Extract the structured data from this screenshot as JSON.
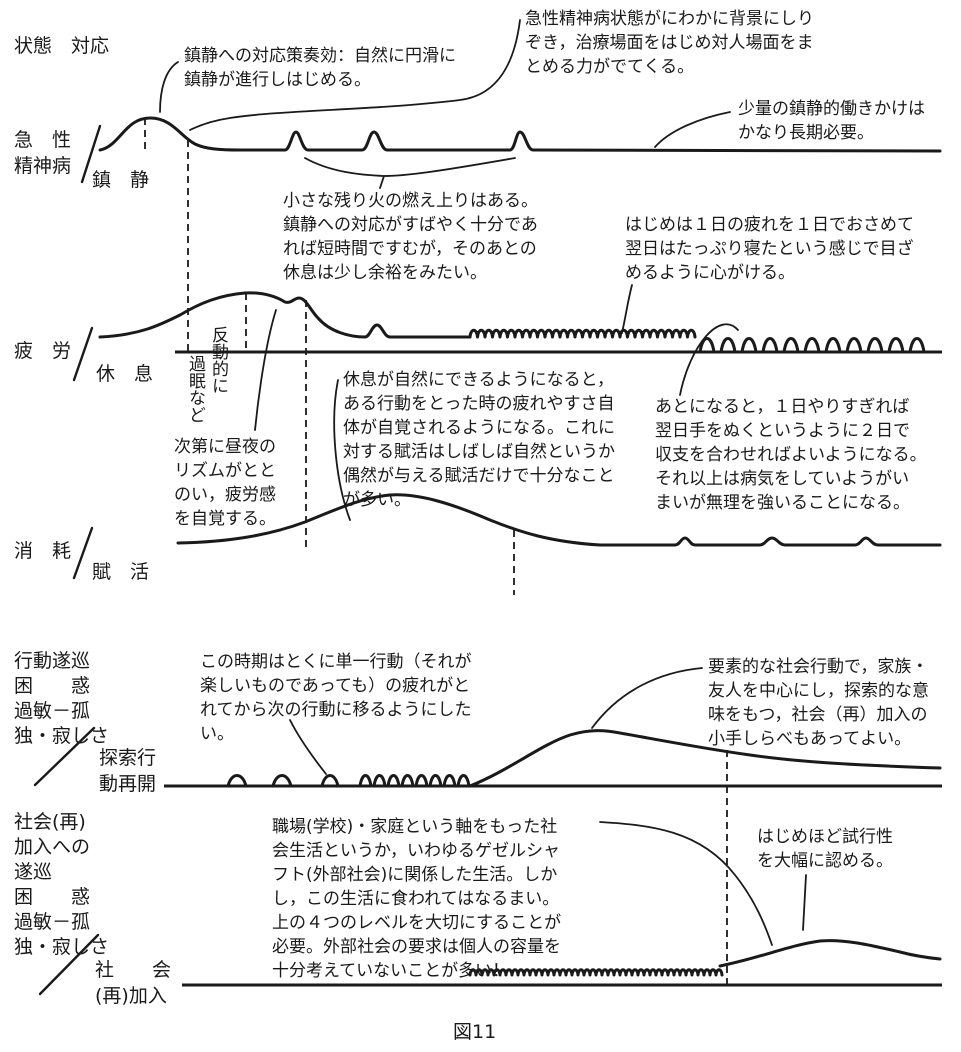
{
  "header": "状態　対応",
  "caption": "図11",
  "rows": {
    "acute": {
      "left": [
        "急　性",
        "精神病"
      ],
      "right": "鎮　静"
    },
    "fatigue": {
      "left": "疲　労",
      "right": "休　息"
    },
    "fatigue_vertical": [
      "反動的に",
      "過眠など"
    ],
    "consume": {
      "left": "消　耗",
      "right": "賦　活"
    },
    "behavior": {
      "left": [
        "行動遂巡",
        "困　　惑",
        "過敏－孤",
        "独・寂しさ"
      ],
      "right": [
        "探索行",
        "動再開"
      ]
    },
    "social": {
      "left": [
        "社会(再)",
        "加入への",
        "遂巡",
        "困　　惑",
        "過敏－孤",
        "独・寂しさ"
      ],
      "right": [
        "社　　会",
        "(再)加入"
      ]
    }
  },
  "notes": {
    "n1": [
      "鎮静への対応策奏効：自然に円滑に",
      "鎮静が進行しはじめる。"
    ],
    "n2": [
      "急性精神病状態がにわかに背景にしり",
      "ぞき，治療場面をはじめ対人場面をま",
      "とめる力がでてくる。"
    ],
    "n3": [
      "少量の鎮静的働きかけは",
      "かなり長期必要。"
    ],
    "n4": [
      "小さな残り火の燃え上りはある。",
      "鎮静への対応がすばやく十分であ",
      "れば短時間ですむが，そのあとの",
      "休息は少し余裕をみたい。"
    ],
    "n5": [
      "はじめは１日の疲れを１日でおさめて",
      "翌日はたっぷり寝たという感じで目ざ",
      "めるように心がける。"
    ],
    "n6": [
      "次第に昼夜の",
      "リズムがとと",
      "のい，疲労感",
      "を自覚する。"
    ],
    "n7": [
      "休息が自然にできるようになると，",
      "ある行動をとった時の疲れやすさ自",
      "体が自覚されるようになる。これに",
      "対する賦活はしばしば自然というか",
      "偶然が与える賦活だけで十分なこと",
      "が多い。"
    ],
    "n8": [
      "あとになると，１日やりすぎれば",
      "翌日手をぬくというように２日で",
      "収支を合わせればよいようになる。",
      "それ以上は病気をしていようがい",
      "まいが無理を強いることになる。"
    ],
    "n9": [
      "この時期はとくに単一行動（それが",
      "楽しいものであっても）の疲れがと",
      "れてから次の行動に移るようにした",
      "い。"
    ],
    "n10": [
      "要素的な社会行動で，家族・",
      "友人を中心にし，探索的な意",
      "味をもつ，社会（再）加入の",
      "小手しらべもあってよい。"
    ],
    "n11": [
      "職場(学校)・家庭という軸をもった社",
      "会生活というか，いわゆるゲゼルシャ",
      "フト(外部社会)に関係した生活。しか",
      "し，この生活に食われてはなるまい。",
      "上の４つのレベルを大切にすることが",
      "必要。外部社会の要求は個人の容量を",
      "十分考えていないことが多い！"
    ],
    "n12": [
      "はじめほど試行性",
      "を大幅に認める。"
    ]
  }
}
